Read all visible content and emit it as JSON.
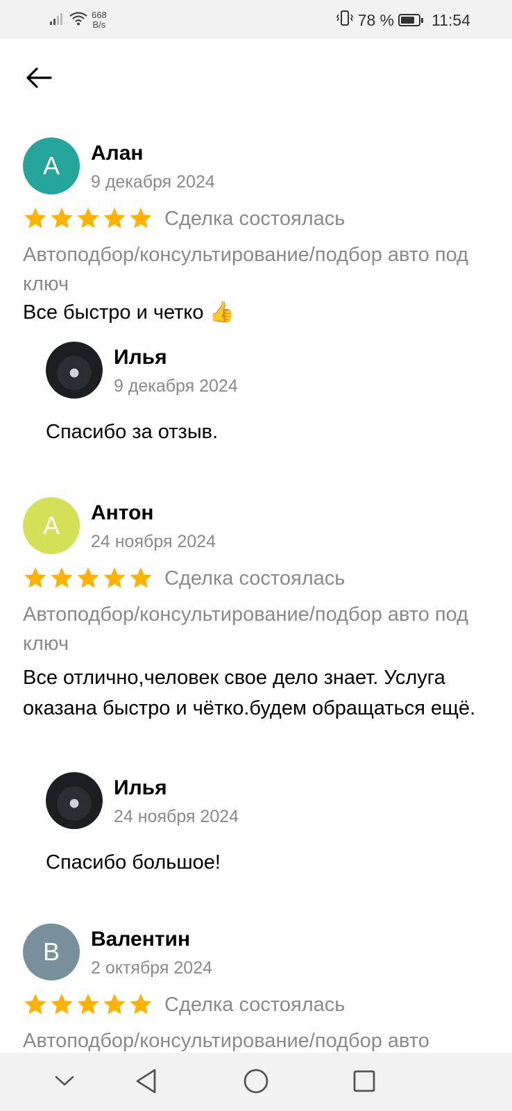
{
  "status_bar": {
    "net_speed_value": "668",
    "net_speed_unit": "B/s",
    "battery_percent": "78 %",
    "battery_level": 0.78,
    "time": "11:54"
  },
  "reviews": [
    {
      "avatar_letter": "А",
      "avatar_color": "#26a69a",
      "name": "Алан",
      "date": "9 декабря 2024",
      "rating": 5,
      "status": "Сделка состоялась",
      "category": "Автоподбор/консультирование/подбор авто под ключ",
      "text": "Все быстро и четко 👍",
      "reply": {
        "name": "Илья",
        "date": "9 декабря 2024",
        "text": "Спасибо за отзыв."
      }
    },
    {
      "avatar_letter": "А",
      "avatar_color": "#d4e157",
      "name": "Антон",
      "date": "24 ноября 2024",
      "rating": 5,
      "status": "Сделка состоялась",
      "category": "Автоподбор/консультирование/подбор авто под ключ",
      "text": "Все отлично,человек свое дело знает. Услуга оказана быстро и чётко.будем обращаться ещё.",
      "reply": {
        "name": "Илья",
        "date": "24 ноября 2024",
        "text": "Спасибо большое!"
      }
    },
    {
      "avatar_letter": "В",
      "avatar_color": "#78909c",
      "name": "Валентин",
      "date": "2 октября 2024",
      "rating": 5,
      "status": "Сделка состоялась",
      "category": "Автоподбор/консультирование/подбор авто"
    }
  ],
  "colors": {
    "star": "#ffb300",
    "muted_text": "#8a8a8a"
  },
  "icons": [
    "signal-icon",
    "wifi-icon",
    "vibrate-icon",
    "battery-icon",
    "back-arrow-icon",
    "star-icon",
    "nav-collapse-icon",
    "nav-back-icon",
    "nav-home-icon",
    "nav-recents-icon"
  ]
}
